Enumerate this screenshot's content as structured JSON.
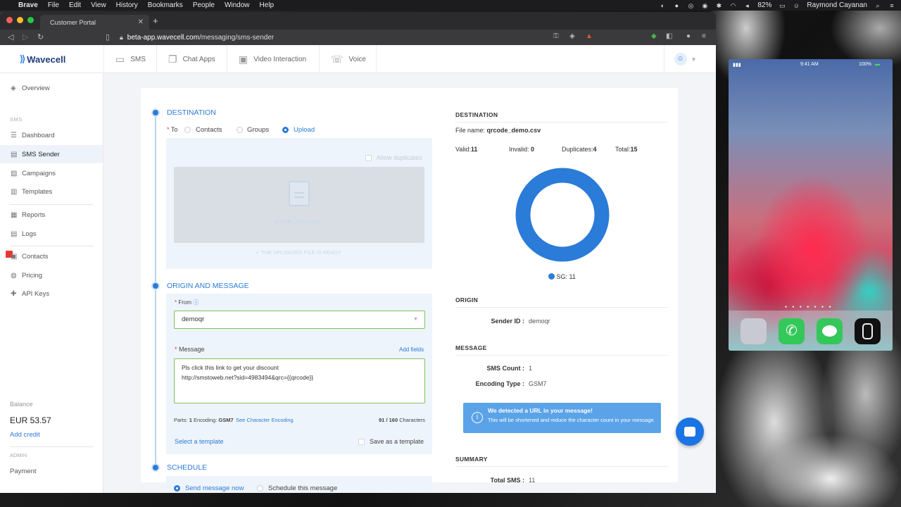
{
  "menubar": {
    "apple": "",
    "items": [
      "Brave",
      "File",
      "Edit",
      "View",
      "History",
      "Bookmarks",
      "People",
      "Window",
      "Help"
    ],
    "battery": "82%",
    "user": "Raymond Cayanan"
  },
  "browser": {
    "tab_title": "Customer Portal",
    "url_host": "beta-app.wavecell.com",
    "url_path": "/messaging/sms-sender"
  },
  "app": {
    "logo": "Wavecell",
    "topnav": [
      {
        "label": "SMS",
        "icon": "sms-icon"
      },
      {
        "label": "Chat Apps",
        "icon": "chat-icon"
      },
      {
        "label": "Video Interaction",
        "icon": "video-icon"
      },
      {
        "label": "Voice",
        "icon": "voice-icon"
      }
    ],
    "sidebar": {
      "overview": "Overview",
      "sms_heading": "SMS",
      "dashboard": "Dashboard",
      "sms_sender": "SMS Sender",
      "campaigns": "Campaigns",
      "templates": "Templates",
      "reports": "Reports",
      "logs": "Logs",
      "contacts": "Contacts",
      "pricing": "Pricing",
      "api_keys": "API Keys",
      "balance_label": "Balance",
      "balance_value": "EUR 53.57",
      "add_credit": "Add credit",
      "admin_heading": "ADMIN",
      "payment": "Payment"
    }
  },
  "form": {
    "destination_title": "DESTINATION",
    "to_label": "To",
    "to_options": [
      "Contacts",
      "Groups",
      "Upload"
    ],
    "to_selected": "Upload",
    "allow_duplicates": "Allow duplicates",
    "uploaded_filename": "qrcode_demo.csv",
    "upload_ready": "THE UPLOADED FILE IS READY",
    "origin_title": "ORIGIN AND MESSAGE",
    "from_label": "From",
    "from_value": "demoqr",
    "message_label": "Message",
    "add_fields": "Add fields",
    "message_line1": "Pls click this link to get your discount",
    "message_line2": "http://smstoweb.net?sid=4983494&qrc={{qrcode}}",
    "parts_label": "Parts:",
    "parts_value": "1",
    "encoding_label": "Encoding:",
    "encoding_value": "GSM7",
    "see_encoding": "See Character Encoding",
    "char_count": "91",
    "char_max": "/ 160",
    "char_suffix": "Characters",
    "select_template": "Select a template",
    "save_template": "Save as a template",
    "schedule_title": "SCHEDULE",
    "send_now": "Send message now",
    "schedule_msg": "Schedule this message"
  },
  "summary": {
    "destination_head": "DESTINATION",
    "file_label": "File name:",
    "file_value": "qrcode_demo.csv",
    "valid_label": "Valid:",
    "valid_value": "11",
    "invalid_label": "Invalid:",
    "invalid_value": "0",
    "dup_label": "Duplicates:",
    "dup_value": "4",
    "total_label": "Total:",
    "total_value": "15",
    "legend": "SG: 11",
    "donut_color": "#2b7bd8",
    "origin_head": "ORIGIN",
    "sender_label": "Sender ID :",
    "sender_value": "demoqr",
    "message_head": "MESSAGE",
    "sms_count_label": "SMS Count :",
    "sms_count_value": "1",
    "enc_type_label": "Encoding Type :",
    "enc_type_value": "GSM7",
    "alert_title": "We detected a URL in your message!",
    "alert_body": "This will be shortened and reduce the character count in your message.",
    "summary_head": "SUMMARY",
    "total_sms_label": "Total SMS :",
    "total_sms_value": "11"
  },
  "chart_data": {
    "type": "pie",
    "categories": [
      "SG"
    ],
    "values": [
      11
    ]
  },
  "phone": {
    "time": "9:41 AM",
    "battery": "100%"
  }
}
